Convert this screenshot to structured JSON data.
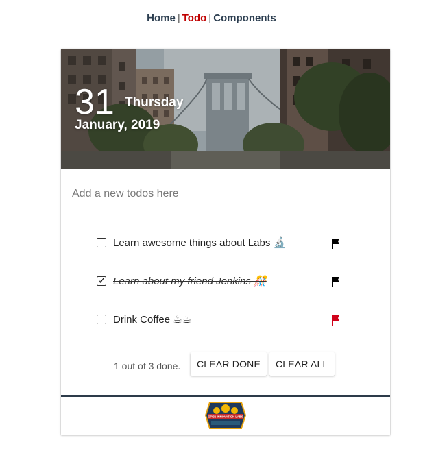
{
  "nav": {
    "items": [
      {
        "label": "Home",
        "active": false
      },
      {
        "label": "Todo",
        "active": true
      },
      {
        "label": "Components",
        "active": false
      }
    ],
    "separator": "|"
  },
  "header": {
    "day": "31",
    "weekday": "Thursday",
    "month_year": "January, 2019"
  },
  "new_todo": {
    "placeholder": "Add a new todos here",
    "value": ""
  },
  "todos": [
    {
      "label": "Learn awesome things about Labs 🔬",
      "checked": false,
      "flag_color": "#000000"
    },
    {
      "label": "Learn about my friend Jenkins 🎊",
      "checked": true,
      "flag_color": "#000000"
    },
    {
      "label": "Drink Coffee ☕☕",
      "checked": false,
      "flag_color": "#d0021b"
    }
  ],
  "summary": {
    "done_count": "1",
    "total_count": "3",
    "text": "1 out of 3 done."
  },
  "actions": {
    "clear_done": "CLEAR DONE",
    "clear_all": "CLEAR ALL"
  },
  "footer": {
    "logo_text": "OPEN INNOVATION LABS"
  },
  "colors": {
    "nav_link": "#2c3e50",
    "nav_active": "#c00000",
    "footer_rule": "#2d3b4a",
    "flag_red": "#d0021b"
  }
}
